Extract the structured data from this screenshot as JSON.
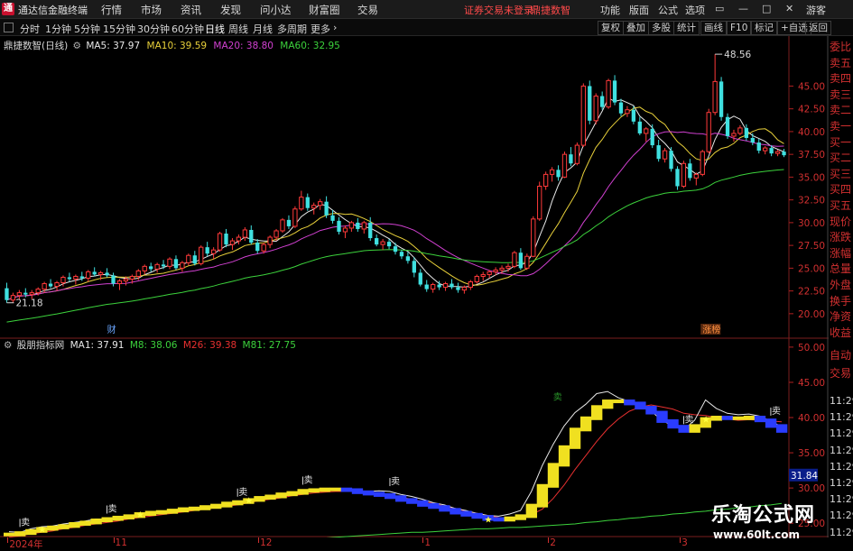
{
  "app_title": "通达信金融终端",
  "menu": [
    "行情",
    "市场",
    "资讯",
    "发现",
    "问小达",
    "财富圈",
    "交易"
  ],
  "warning": "证券交易未登录",
  "broker": "鼎捷数智",
  "right_menu": [
    "功能",
    "版面",
    "公式",
    "选项"
  ],
  "guest": "游客",
  "tabs": [
    "分时",
    "1分钟",
    "5分钟",
    "15分钟",
    "30分钟",
    "60分钟",
    "日线",
    "周线",
    "月线",
    "多周期",
    "更多"
  ],
  "active_tab": "日线",
  "right_buttons": [
    "复权",
    "叠加",
    "多股",
    "统计",
    "画线",
    "F10",
    "标记",
    "+自选",
    "返回"
  ],
  "main_panel": {
    "title": "鼎捷数智(日线)",
    "ma_labels": [
      {
        "text": "MA5: 37.97",
        "color": "#e8e8e8"
      },
      {
        "text": "MA10: 39.59",
        "color": "#e8d03a"
      },
      {
        "text": "MA20: 38.80",
        "color": "#d040d0"
      },
      {
        "text": "MA60: 32.95",
        "color": "#3cd23c"
      }
    ],
    "y_ticks": [
      "45.00",
      "42.50",
      "40.00",
      "37.50",
      "35.00",
      "32.50",
      "30.00",
      "27.50",
      "25.00",
      "22.50",
      "20.00"
    ],
    "high_label": "48.56",
    "low_label": "21.18",
    "marker_cai": "财",
    "marker_zhangbang": "涨榜"
  },
  "ind_panel": {
    "title": "股朋指标网",
    "labels": [
      {
        "text": "MA1: 37.91",
        "color": "#e8e8e8"
      },
      {
        "text": "M8: 38.06",
        "color": "#3cd23c"
      },
      {
        "text": "M26: 39.38",
        "color": "#e83030"
      },
      {
        "text": "M81: 27.75",
        "color": "#3cd23c"
      }
    ],
    "y_ticks": [
      "50.00",
      "45.00",
      "40.00",
      "35.00",
      "30.00",
      "25.00"
    ],
    "current_value": "31.84",
    "sell_label": "卖"
  },
  "right_panel": [
    "委比",
    "卖五",
    "卖四",
    "卖三",
    "卖二",
    "卖一",
    "买一",
    "买二",
    "买三",
    "买四",
    "买五",
    "现价",
    "涨跌",
    "涨幅",
    "总量",
    "外盘",
    "换手",
    "净资",
    "收益"
  ],
  "right_panel2": [
    "自动",
    "交易"
  ],
  "right_times": [
    "11:29",
    "11:29",
    "11:29",
    "11:29",
    "11:29",
    "11:29",
    "11:29",
    "11:29",
    "11:29"
  ],
  "x_labels": [
    "2024年",
    "11",
    "12",
    "1",
    "2",
    "3"
  ],
  "watermark": {
    "name": "乐淘公式网",
    "url": "www.60lt.com"
  },
  "colors": {
    "up": "#ff3a3a",
    "down": "#3fe0e0",
    "ma5": "#e8e8e8",
    "ma10": "#e8d03a",
    "ma20": "#d040d0",
    "ma60": "#3cd23c",
    "grid": "#7a1e1e"
  },
  "chart_data": [
    {
      "type": "candlestick",
      "title": "鼎捷数智(日线)",
      "ylim": [
        18.5,
        49.5
      ],
      "ohlc": [
        [
          22.8,
          23.4,
          21.2,
          21.5
        ],
        [
          21.5,
          22.3,
          21.2,
          22.0
        ],
        [
          22.0,
          22.6,
          21.6,
          22.3
        ],
        [
          22.3,
          22.8,
          21.8,
          22.1
        ],
        [
          22.1,
          22.6,
          21.6,
          22.3
        ],
        [
          22.3,
          22.9,
          22.0,
          22.7
        ],
        [
          22.7,
          23.5,
          22.3,
          23.3
        ],
        [
          23.3,
          23.8,
          22.8,
          23.0
        ],
        [
          23.0,
          23.6,
          22.5,
          23.4
        ],
        [
          23.4,
          24.2,
          23.0,
          24.0
        ],
        [
          24.0,
          24.5,
          23.5,
          23.8
        ],
        [
          23.8,
          24.3,
          23.2,
          24.1
        ],
        [
          24.1,
          24.6,
          23.6,
          23.9
        ],
        [
          23.9,
          24.8,
          23.5,
          24.6
        ],
        [
          24.6,
          25.1,
          24.1,
          24.3
        ],
        [
          24.3,
          24.7,
          23.7,
          24.5
        ],
        [
          24.5,
          25.0,
          24.0,
          24.2
        ],
        [
          24.2,
          24.5,
          23.0,
          23.3
        ],
        [
          23.3,
          23.8,
          22.6,
          23.6
        ],
        [
          23.6,
          24.1,
          23.1,
          23.8
        ],
        [
          23.8,
          24.3,
          23.3,
          24.1
        ],
        [
          24.1,
          24.9,
          23.7,
          24.7
        ],
        [
          24.7,
          25.4,
          24.3,
          25.2
        ],
        [
          25.2,
          25.6,
          24.6,
          24.9
        ],
        [
          24.9,
          25.6,
          24.5,
          25.4
        ],
        [
          25.4,
          25.9,
          24.9,
          25.2
        ],
        [
          25.2,
          26.2,
          24.9,
          26.0
        ],
        [
          26.0,
          26.4,
          24.8,
          25.0
        ],
        [
          25.0,
          25.8,
          24.6,
          25.6
        ],
        [
          25.6,
          26.6,
          25.3,
          26.4
        ],
        [
          26.4,
          26.9,
          25.3,
          25.5
        ],
        [
          25.5,
          27.5,
          25.3,
          27.3
        ],
        [
          27.3,
          27.9,
          26.3,
          26.6
        ],
        [
          26.6,
          27.3,
          26.0,
          27.0
        ],
        [
          27.0,
          29.0,
          26.8,
          28.8
        ],
        [
          28.8,
          29.3,
          27.3,
          27.6
        ],
        [
          27.6,
          28.3,
          27.0,
          28.0
        ],
        [
          28.0,
          28.7,
          27.6,
          28.4
        ],
        [
          28.4,
          29.5,
          28.0,
          29.2
        ],
        [
          29.2,
          29.7,
          27.6,
          27.8
        ],
        [
          27.8,
          28.2,
          26.6,
          26.9
        ],
        [
          26.9,
          27.8,
          26.6,
          27.6
        ],
        [
          27.6,
          28.6,
          27.2,
          28.4
        ],
        [
          28.4,
          29.3,
          28.0,
          29.1
        ],
        [
          29.1,
          30.5,
          28.9,
          30.3
        ],
        [
          30.3,
          30.8,
          29.3,
          29.6
        ],
        [
          29.6,
          31.8,
          29.4,
          31.5
        ],
        [
          31.5,
          33.5,
          31.3,
          32.8
        ],
        [
          32.8,
          33.2,
          31.3,
          31.6
        ],
        [
          31.6,
          32.2,
          30.9,
          31.9
        ],
        [
          31.9,
          32.6,
          31.4,
          32.3
        ],
        [
          32.3,
          32.9,
          30.5,
          30.8
        ],
        [
          30.8,
          31.4,
          29.9,
          30.2
        ],
        [
          30.2,
          30.6,
          28.7,
          29.0
        ],
        [
          29.0,
          29.7,
          28.3,
          29.4
        ],
        [
          29.4,
          30.2,
          29.0,
          30.0
        ],
        [
          30.0,
          30.5,
          29.0,
          29.3
        ],
        [
          29.3,
          30.2,
          28.8,
          30.0
        ],
        [
          30.0,
          30.6,
          28.0,
          28.3
        ],
        [
          28.3,
          28.7,
          27.4,
          27.6
        ],
        [
          27.6,
          28.2,
          27.0,
          27.9
        ],
        [
          27.9,
          28.2,
          27.1,
          27.4
        ],
        [
          27.4,
          27.8,
          26.5,
          26.8
        ],
        [
          26.8,
          27.0,
          26.0,
          26.3
        ],
        [
          26.3,
          26.8,
          25.5,
          25.8
        ],
        [
          25.8,
          26.2,
          24.0,
          24.5
        ],
        [
          24.5,
          24.9,
          23.0,
          23.2
        ],
        [
          23.2,
          23.7,
          22.4,
          22.7
        ],
        [
          22.7,
          23.4,
          22.3,
          23.2
        ],
        [
          23.2,
          23.6,
          22.6,
          22.9
        ],
        [
          22.9,
          23.5,
          22.5,
          23.3
        ],
        [
          23.3,
          23.8,
          22.7,
          22.9
        ],
        [
          22.9,
          23.4,
          22.3,
          22.6
        ],
        [
          22.6,
          23.1,
          22.2,
          22.9
        ],
        [
          22.9,
          23.7,
          22.6,
          23.5
        ],
        [
          23.5,
          24.3,
          23.3,
          24.1
        ],
        [
          24.1,
          24.6,
          23.6,
          24.3
        ],
        [
          24.3,
          24.8,
          23.9,
          24.6
        ],
        [
          24.6,
          25.1,
          24.2,
          24.8
        ],
        [
          24.8,
          25.3,
          24.4,
          25.0
        ],
        [
          25.0,
          25.5,
          24.6,
          25.2
        ],
        [
          25.2,
          26.9,
          25.0,
          26.7
        ],
        [
          26.7,
          27.2,
          24.8,
          25.0
        ],
        [
          25.0,
          26.6,
          24.8,
          26.3
        ],
        [
          26.3,
          30.7,
          26.2,
          30.4
        ],
        [
          30.4,
          34.5,
          30.2,
          34.0
        ],
        [
          34.0,
          35.6,
          33.6,
          35.3
        ],
        [
          35.3,
          36.1,
          34.5,
          35.8
        ],
        [
          35.8,
          36.3,
          34.6,
          35.0
        ],
        [
          35.0,
          37.8,
          34.9,
          37.5
        ],
        [
          37.5,
          38.3,
          36.2,
          36.5
        ],
        [
          36.5,
          38.8,
          36.3,
          38.5
        ],
        [
          38.5,
          45.3,
          38.3,
          45.0
        ],
        [
          45.0,
          45.6,
          40.8,
          41.2
        ],
        [
          41.2,
          44.2,
          40.8,
          43.9
        ],
        [
          43.9,
          44.4,
          42.4,
          42.7
        ],
        [
          42.7,
          45.8,
          42.5,
          45.6
        ],
        [
          45.6,
          46.2,
          42.9,
          43.2
        ],
        [
          43.2,
          43.6,
          41.7,
          42.0
        ],
        [
          42.0,
          42.8,
          41.6,
          42.4
        ],
        [
          42.4,
          42.8,
          40.8,
          41.1
        ],
        [
          41.1,
          41.6,
          39.6,
          39.8
        ],
        [
          39.8,
          40.5,
          38.9,
          40.3
        ],
        [
          40.3,
          40.8,
          38.2,
          38.5
        ],
        [
          38.5,
          39.1,
          36.7,
          37.0
        ],
        [
          37.0,
          38.2,
          36.6,
          37.9
        ],
        [
          37.9,
          38.3,
          35.6,
          35.9
        ],
        [
          35.9,
          36.2,
          33.6,
          34.0
        ],
        [
          34.0,
          36.8,
          33.8,
          36.5
        ],
        [
          36.5,
          37.0,
          34.6,
          34.9
        ],
        [
          34.9,
          35.5,
          34.1,
          35.3
        ],
        [
          35.3,
          38.0,
          35.1,
          37.8
        ],
        [
          37.8,
          42.5,
          37.6,
          42.1
        ],
        [
          42.1,
          48.5,
          41.8,
          45.5
        ],
        [
          45.5,
          46.0,
          41.2,
          41.6
        ],
        [
          41.6,
          42.0,
          39.2,
          39.5
        ],
        [
          39.5,
          40.2,
          38.9,
          39.8
        ],
        [
          39.8,
          40.7,
          39.6,
          40.4
        ],
        [
          40.4,
          40.8,
          39.0,
          39.3
        ],
        [
          39.3,
          39.8,
          38.5,
          38.8
        ],
        [
          38.8,
          39.2,
          37.6,
          37.9
        ],
        [
          37.9,
          38.4,
          37.5,
          38.2
        ],
        [
          38.2,
          38.5,
          37.3,
          37.6
        ],
        [
          37.6,
          38.0,
          37.3,
          37.8
        ],
        [
          37.8,
          38.1,
          37.2,
          37.4
        ]
      ],
      "moving_averages": [
        "MA5",
        "MA10",
        "MA20",
        "MA60"
      ]
    },
    {
      "type": "line",
      "title": "股朋指标网",
      "ylim": [
        24.0,
        50.5
      ],
      "series": [
        {
          "name": "MA1",
          "values": [
            23.8,
            23.7,
            24.2,
            24.5,
            24.6,
            24.9,
            25.1,
            25.3,
            25.6,
            25.6,
            25.9,
            26.0,
            26.3,
            26.5,
            26.5,
            26.7,
            27.1,
            27.0,
            27.3,
            27.5,
            27.8,
            27.8,
            28.3,
            28.6,
            28.7,
            29.0,
            29.2,
            29.7,
            29.8,
            29.9,
            29.9,
            29.8,
            29.6,
            29.5,
            29.6,
            29.5,
            29.1,
            28.8,
            28.4,
            27.9,
            27.6,
            27.1,
            26.8,
            26.4,
            26.1,
            26.0,
            26.3,
            26.8,
            29.5,
            33.2,
            36.2,
            38.8,
            40.7,
            41.9,
            43.4,
            43.7,
            42.8,
            42.3,
            41.6,
            40.9,
            39.6,
            38.8,
            38.3,
            39.6,
            42.5,
            41.3,
            40.6,
            40.4,
            40.5,
            40.2,
            39.5,
            38.7
          ]
        },
        {
          "name": "M8",
          "values": [
            23.4,
            23.6,
            23.9,
            24.2,
            24.4,
            24.6,
            24.9,
            25.1,
            25.4,
            25.6,
            25.8,
            26.0,
            26.3,
            26.5,
            26.6,
            26.8,
            27.0,
            27.1,
            27.3,
            27.5,
            27.8,
            28.0,
            28.3,
            28.6,
            28.8,
            29.1,
            29.3,
            29.6,
            29.7,
            29.8,
            29.8,
            29.7,
            29.4,
            29.2,
            29.0,
            28.7,
            28.3,
            28.0,
            27.6,
            27.3,
            26.9,
            26.5,
            26.2,
            25.9,
            25.6,
            25.5,
            25.7,
            26.0,
            27.5,
            30.3,
            33.3,
            35.8,
            38.3,
            39.9,
            41.5,
            42.3,
            42.3,
            42.0,
            41.4,
            40.7,
            39.5,
            38.7,
            38.1,
            38.8,
            39.8,
            40.0,
            39.9,
            39.9,
            40.0,
            39.6,
            38.8,
            38.1
          ]
        },
        {
          "name": "M26",
          "values": [
            23.0,
            23.2,
            23.5,
            23.7,
            23.9,
            24.2,
            24.4,
            24.7,
            24.9,
            25.1,
            25.3,
            25.6,
            25.8,
            26.0,
            26.2,
            26.4,
            26.6,
            26.8,
            27.0,
            27.2,
            27.4,
            27.6,
            27.9,
            28.2,
            28.4,
            28.6,
            28.9,
            29.1,
            29.3,
            29.4,
            29.5,
            29.5,
            29.5,
            29.4,
            29.2,
            29.0,
            28.7,
            28.4,
            28.1,
            27.8,
            27.4,
            27.1,
            26.7,
            26.4,
            26.1,
            25.8,
            25.6,
            25.7,
            26.2,
            27.0,
            28.5,
            30.4,
            32.6,
            34.6,
            36.6,
            38.4,
            39.8,
            40.9,
            41.5,
            41.8,
            41.5,
            41.2,
            40.6,
            40.4,
            40.3,
            40.0,
            39.8,
            39.6,
            39.7,
            39.6,
            39.5,
            39.4
          ]
        },
        {
          "name": "M81",
          "values": [
            20.0,
            20.1,
            20.2,
            20.3,
            20.4,
            20.5,
            20.6,
            20.7,
            20.8,
            20.9,
            21.0,
            21.1,
            21.2,
            21.3,
            21.4,
            21.5,
            21.6,
            21.7,
            21.8,
            21.9,
            22.0,
            22.1,
            22.2,
            22.3,
            22.4,
            22.5,
            22.6,
            22.7,
            22.8,
            22.9,
            23.0,
            23.1,
            23.2,
            23.3,
            23.4,
            23.5,
            23.6,
            23.7,
            23.7,
            23.8,
            23.9,
            24.0,
            24.1,
            24.2,
            24.2,
            24.3,
            24.4,
            24.4,
            24.5,
            24.6,
            24.7,
            24.8,
            24.9,
            25.1,
            25.2,
            25.4,
            25.5,
            25.7,
            25.8,
            26.0,
            26.1,
            26.3,
            26.4,
            26.6,
            26.7,
            26.9,
            27.0,
            27.2,
            27.3,
            27.5,
            27.6,
            27.8
          ]
        }
      ]
    }
  ]
}
